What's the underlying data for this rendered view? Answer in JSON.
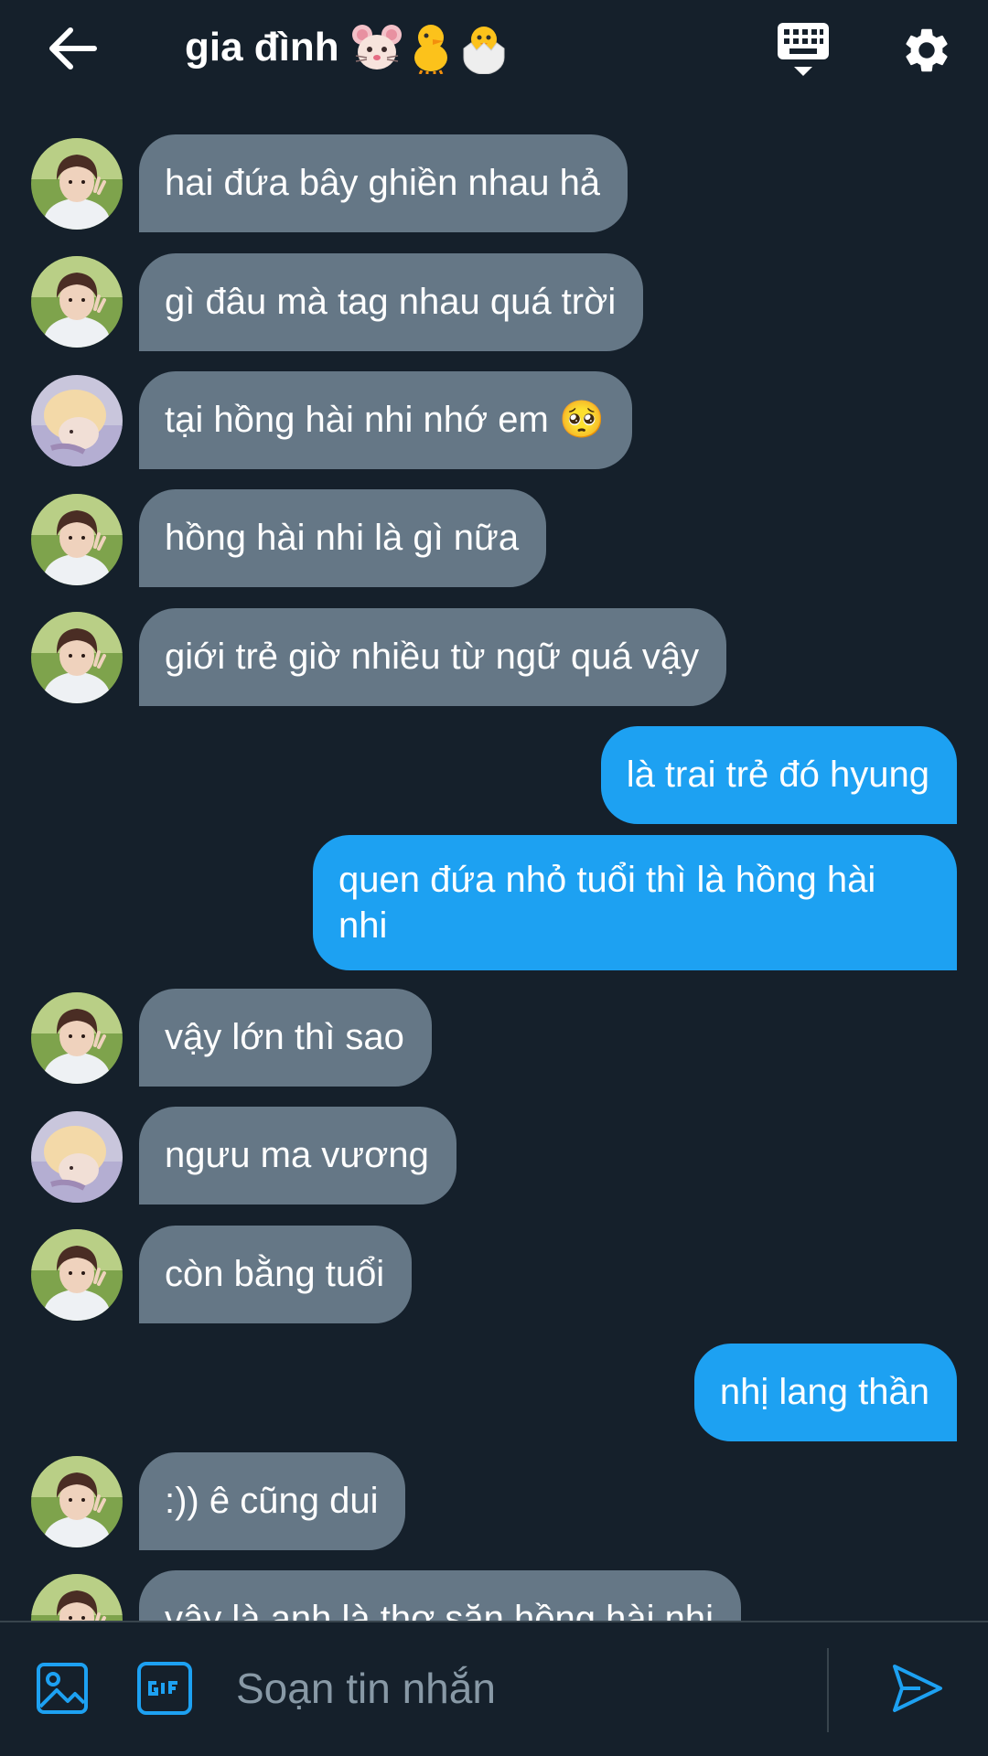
{
  "header": {
    "title": "gia đình",
    "title_emojis": [
      "mouse-face-icon",
      "baby-chick-icon",
      "hatching-chick-icon"
    ],
    "icons": {
      "back": "back-arrow-icon",
      "keyboard": "keyboard-icon",
      "settings": "gear-icon"
    }
  },
  "conversation": {
    "messages": [
      {
        "direction": "in",
        "avatar": "avatar-a",
        "text": "hai đứa bây ghiền nhau hả"
      },
      {
        "direction": "in",
        "avatar": "avatar-a",
        "text": "gì đâu mà tag nhau quá trời"
      },
      {
        "direction": "in",
        "avatar": "avatar-b",
        "text": "tại hồng hài nhi nhớ em 🥺"
      },
      {
        "direction": "in",
        "avatar": "avatar-a",
        "text": "hồng hài nhi là gì nữa"
      },
      {
        "direction": "in",
        "avatar": "avatar-a",
        "text": "giới trẻ giờ nhiều từ ngữ quá vậy"
      },
      {
        "direction": "out",
        "text": "là trai trẻ đó hyung"
      },
      {
        "direction": "out",
        "text": "quen đứa nhỏ tuổi thì là hồng hài nhi"
      },
      {
        "direction": "in",
        "avatar": "avatar-a",
        "text": "vậy lớn thì sao"
      },
      {
        "direction": "in",
        "avatar": "avatar-b",
        "text": "ngưu ma vương"
      },
      {
        "direction": "in",
        "avatar": "avatar-a",
        "text": "còn bằng tuổi"
      },
      {
        "direction": "out",
        "text": "nhị lang thần"
      },
      {
        "direction": "in",
        "avatar": "avatar-a",
        "text": ":)) ê cũng dui"
      },
      {
        "direction": "in",
        "avatar": "avatar-a",
        "text": "vậy là anh là thợ săn hồng hài nhi"
      }
    ]
  },
  "composer": {
    "placeholder": "Soạn tin nhắn",
    "value": "",
    "icons": {
      "image": "image-icon",
      "gif": "gif-icon",
      "send": "send-icon"
    }
  },
  "colors": {
    "background": "#15202b",
    "incoming_bubble": "#657786",
    "outgoing_bubble": "#1da1f2",
    "accent": "#1da1f2",
    "placeholder": "#8899a6",
    "divider": "#38444d"
  }
}
